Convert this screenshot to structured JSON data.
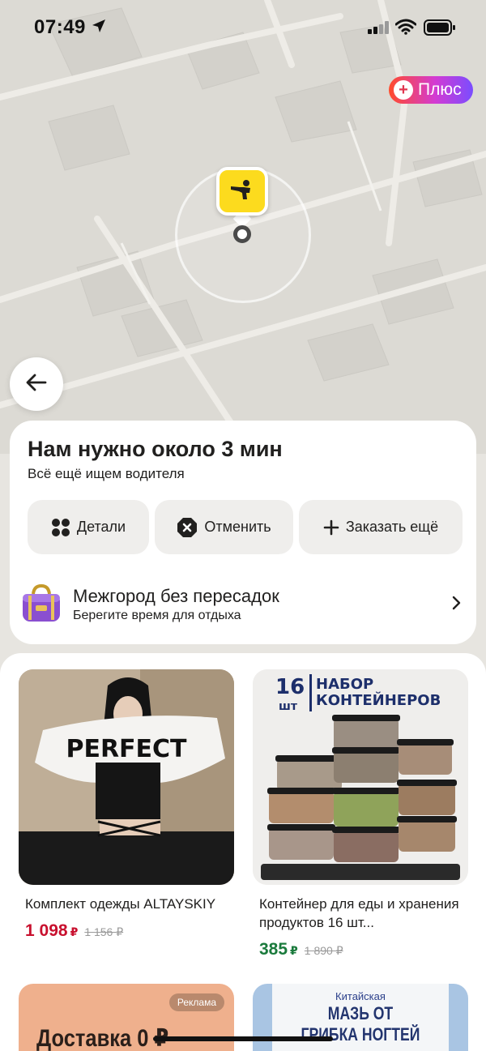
{
  "status_bar": {
    "time": "07:49"
  },
  "map": {
    "plus_badge": "Плюс"
  },
  "order": {
    "title": "Нам нужно около 3 мин",
    "subtitle": "Всё ещё ищем водителя",
    "actions": {
      "details": "Детали",
      "cancel": "Отменить",
      "order_more": "Заказать ещё"
    },
    "promo": {
      "title": "Межгород без пересадок",
      "subtitle": "Берегите время для отдыха"
    }
  },
  "feed": {
    "products": [
      {
        "title": "Комплект одежды ALTAYSKIY",
        "price": "1 098",
        "currency": "₽",
        "old_price": "1 156 ₽",
        "price_color": "#c8102e",
        "image_text": "PERFECT"
      },
      {
        "title": "Контейнер для еды и хранения продуктов 16 шт...",
        "price": "385",
        "currency": "₽",
        "old_price": "1 890 ₽",
        "price_color": "#1a7a3c",
        "image_heading_count": "16",
        "image_heading_unit": "шт",
        "image_heading_line1": "НАБОР",
        "image_heading_line2": "КОНТЕЙНЕРОВ"
      }
    ],
    "ad_tile": {
      "badge": "Реклама",
      "text": "Доставка 0 ₽"
    },
    "ointment_tile": {
      "small": "Китайская",
      "line1": "МАЗЬ ОТ",
      "line2": "ГРИБКА НОГТЕЙ"
    }
  },
  "colors": {
    "accent_yellow": "#fcdb1e",
    "card_bg": "#ffffff",
    "button_bg": "#efeeec"
  }
}
